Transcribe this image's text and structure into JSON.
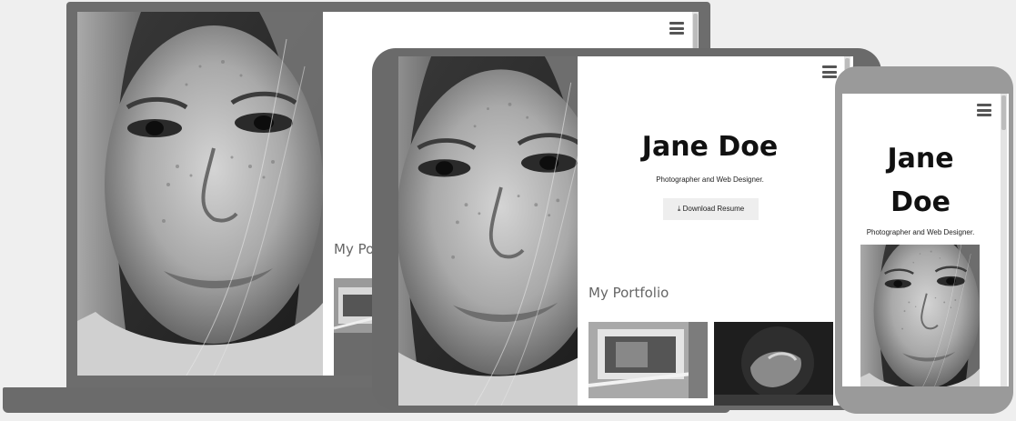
{
  "profile": {
    "name": "Jane Doe",
    "subtitle": "Photographer and Web Designer.",
    "resume_button": "Download Resume",
    "resume_icon": "download-icon",
    "portfolio_heading": "My Portfolio",
    "portfolio_heading_truncated": "My Po"
  },
  "icons": {
    "menu": "hamburger-menu-icon"
  },
  "colors": {
    "background": "#efefef",
    "device_frame_dark": "#6d6d6d",
    "device_frame_light": "#9a9a9a",
    "heading_text": "#111111",
    "section_text": "#666666",
    "button_background": "#eeeeee"
  }
}
